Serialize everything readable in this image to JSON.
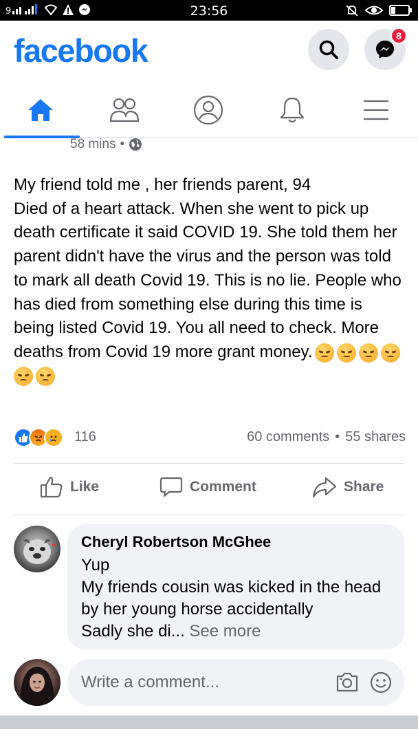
{
  "status_bar": {
    "time": "23:56",
    "left_icons": [
      "signal-icon",
      "wifi-icon",
      "warning-icon",
      "messenger-notify-icon"
    ],
    "right_icons": [
      "mute-icon",
      "eye-icon",
      "battery-icon"
    ]
  },
  "header": {
    "logo": "facebook",
    "messenger_badge": "8"
  },
  "nav": {
    "tabs": [
      "home",
      "friends",
      "profile",
      "notifications",
      "menu"
    ],
    "active": "home"
  },
  "post": {
    "time": "58 mins",
    "separator": "•",
    "text": "My friend told me , her friends parent, 94\nDied of a heart attack. When she went to pick up death certificate it said COVID 19. She told them her parent didn't have the virus and the person was told to mark all death Covid 19. This is no lie. People who has died from something else during this time is being listed Covid 19. You all need to check. More deaths from Covid 19 more grant money.",
    "reaction_count": "116",
    "comments": "60 comments",
    "dot": "•",
    "shares": "55 shares"
  },
  "actions": {
    "like": "Like",
    "comment": "Comment",
    "share": "Share"
  },
  "comment": {
    "author": "Cheryl Robertson McGhee",
    "text": "Yup\nMy friends cousin was kicked in the head by her young horse accidentally\nSadly she di... ",
    "see_more": "See more"
  },
  "write_comment": {
    "placeholder": "Write a comment..."
  },
  "colors": {
    "brand": "#1877f2",
    "badge": "#e41e3f"
  }
}
